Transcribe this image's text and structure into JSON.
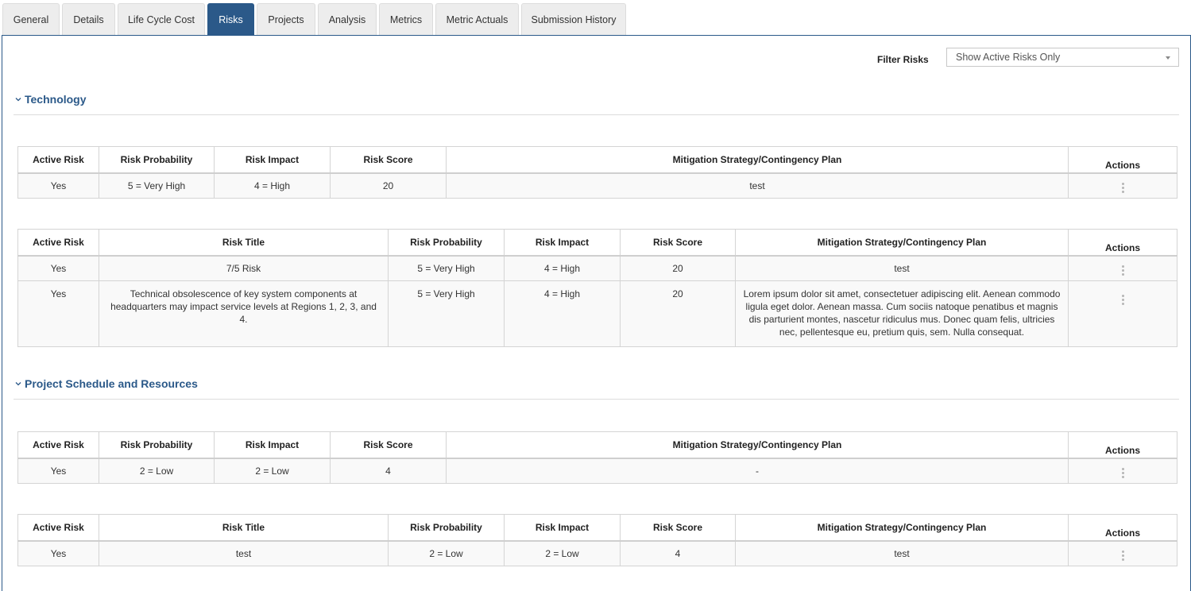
{
  "tabs": [
    {
      "label": "General"
    },
    {
      "label": "Details"
    },
    {
      "label": "Life Cycle Cost"
    },
    {
      "label": "Risks",
      "active": true
    },
    {
      "label": "Projects"
    },
    {
      "label": "Analysis"
    },
    {
      "label": "Metrics"
    },
    {
      "label": "Metric Actuals"
    },
    {
      "label": "Submission History"
    }
  ],
  "filter": {
    "label": "Filter Risks",
    "value": "Show Active Risks Only"
  },
  "columns": {
    "active": "Active Risk",
    "title": "Risk Title",
    "probability": "Risk Probability",
    "impact": "Risk Impact",
    "score": "Risk Score",
    "mitigation": "Mitigation Strategy/Contingency Plan",
    "actions": "Actions"
  },
  "sections": [
    {
      "title": "Technology",
      "summary_row": {
        "active": "Yes",
        "probability": "5 = Very High",
        "impact": "4 = High",
        "score": "20",
        "mitigation": "test"
      },
      "detail_rows": [
        {
          "active": "Yes",
          "title": "7/5 Risk",
          "probability": "5 = Very High",
          "impact": "4 = High",
          "score": "20",
          "mitigation": "test"
        },
        {
          "active": "Yes",
          "title": "Technical obsolescence of key system components at headquarters may impact service levels at Regions 1, 2, 3, and 4.",
          "probability": "5 = Very High",
          "impact": "4 = High",
          "score": "20",
          "mitigation": "Lorem ipsum dolor sit amet, consectetuer adipiscing elit. Aenean commodo ligula eget dolor. Aenean massa. Cum sociis natoque penatibus et magnis dis parturient montes, nascetur ridiculus mus. Donec quam felis, ultricies nec, pellentesque eu, pretium quis, sem. Nulla consequat."
        }
      ]
    },
    {
      "title": "Project Schedule and Resources",
      "summary_row": {
        "active": "Yes",
        "probability": "2 = Low",
        "impact": "2 = Low",
        "score": "4",
        "mitigation": "-"
      },
      "detail_rows": [
        {
          "active": "Yes",
          "title": "test",
          "probability": "2 = Low",
          "impact": "2 = Low",
          "score": "4",
          "mitigation": "test"
        }
      ]
    }
  ],
  "icons": {
    "section_toggle": "chevron-down-icon",
    "row_actions": "kebab-menu-icon",
    "select_caret": "caret-down-icon"
  },
  "colors": {
    "accent": "#2b5989",
    "tab_bg": "#ededed",
    "cell_bg": "#f9f9f9"
  }
}
